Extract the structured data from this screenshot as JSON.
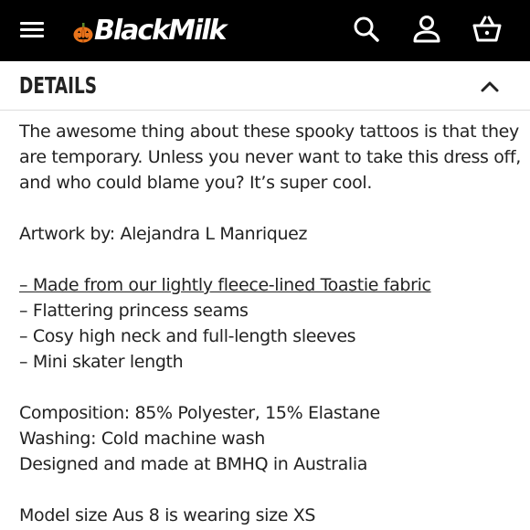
{
  "header": {
    "brand": "BlackMilk",
    "menu_icon": "hamburger-menu-icon",
    "search_icon": "search-icon",
    "account_icon": "account-icon",
    "cart_icon": "cart-icon",
    "background": "#000000",
    "foreground": "#ffffff",
    "pumpkin_color": "#e8741c"
  },
  "details": {
    "title": "DETAILS",
    "toggle_icon": "chevron-up-icon",
    "expanded": true,
    "description": [
      "The awesome thing about these spooky tattoos is that they",
      "are temporary. Unless you never want to take this dress off,",
      "and who could blame you? It’s super cool."
    ],
    "artwork": "Artwork by: Alejandra L Manriquez",
    "features": {
      "link": "– Made from our lightly fleece-lined Toastie fabric",
      "items": [
        "– Flattering princess seams",
        "– Cosy high neck and full-length sleeves",
        "– Mini skater length"
      ]
    },
    "composition": "Composition: 85% Polyester, 15% Elastane",
    "washing": "Washing: Cold machine wash",
    "origin": "Designed and made at BMHQ in Australia",
    "model_size": "Model size Aus 8 is wearing size XS"
  }
}
